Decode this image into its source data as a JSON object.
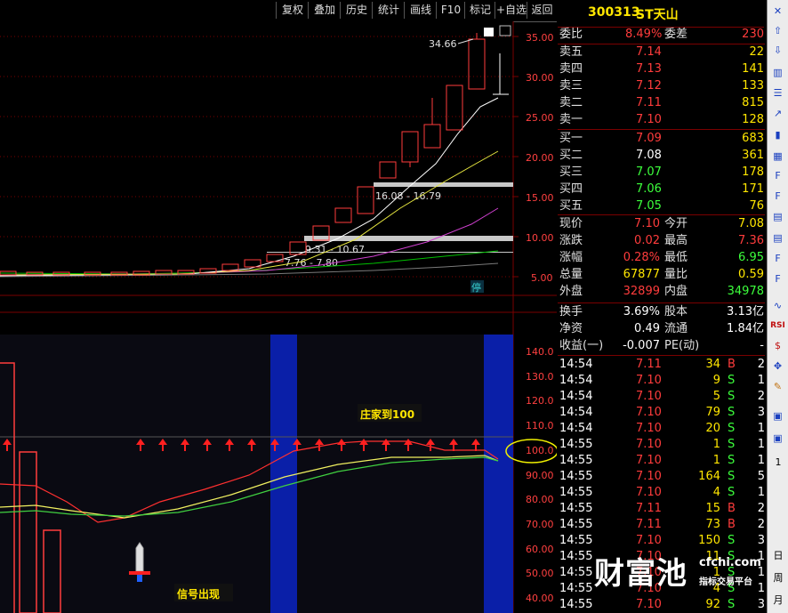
{
  "toolbar": {
    "buttons": [
      "复权",
      "叠加",
      "历史",
      "统计",
      "画线",
      "F10",
      "标记",
      "+自选",
      "返回"
    ]
  },
  "stock": {
    "code": "300313",
    "name": "ST天山"
  },
  "price_chart": {
    "axis_labels": [
      "35.00",
      "30.00",
      "25.00",
      "20.00",
      "15.00",
      "10.00",
      "5.00"
    ],
    "high_label": "34.66",
    "zone_labels": [
      "16.08 - 16.79",
      "9.31 - 10.67",
      "7.76 - 7.80"
    ],
    "suspend_badge": "停"
  },
  "indicator_chart": {
    "axis_labels": [
      "140.0",
      "130.0",
      "120.0",
      "110.0",
      "100.0",
      "90.00",
      "80.00",
      "70.00",
      "60.00",
      "50.00",
      "40.00"
    ],
    "annotation_top": "庄家到100",
    "annotation_bottom": "信号出现"
  },
  "quote": {
    "weibi_label": "委比",
    "weibi_value": "8.49%",
    "weicha_label": "委差",
    "weicha_value": "230",
    "sells": [
      {
        "label": "卖五",
        "price": "7.14",
        "vol": "22"
      },
      {
        "label": "卖四",
        "price": "7.13",
        "vol": "141"
      },
      {
        "label": "卖三",
        "price": "7.12",
        "vol": "133"
      },
      {
        "label": "卖二",
        "price": "7.11",
        "vol": "815"
      },
      {
        "label": "卖一",
        "price": "7.10",
        "vol": "128"
      }
    ],
    "buys": [
      {
        "label": "买一",
        "price": "7.09",
        "vol": "683"
      },
      {
        "label": "买二",
        "price": "7.08",
        "vol": "361"
      },
      {
        "label": "买三",
        "price": "7.07",
        "vol": "178"
      },
      {
        "label": "买四",
        "price": "7.06",
        "vol": "171"
      },
      {
        "label": "买五",
        "price": "7.05",
        "vol": "76"
      }
    ],
    "stats": [
      {
        "l1": "现价",
        "v1": "7.10",
        "l2": "今开",
        "v2": "7.08"
      },
      {
        "l1": "涨跌",
        "v1": "0.02",
        "l2": "最高",
        "v2": "7.36"
      },
      {
        "l1": "涨幅",
        "v1": "0.28%",
        "l2": "最低",
        "v2": "6.95"
      },
      {
        "l1": "总量",
        "v1": "67877",
        "l2": "量比",
        "v2": "0.59"
      },
      {
        "l1": "外盘",
        "v1": "32899",
        "l2": "内盘",
        "v2": "34978"
      }
    ],
    "fin": [
      {
        "l1": "换手",
        "v1": "3.69%",
        "l2": "股本",
        "v2": "3.13亿"
      },
      {
        "l1": "净资",
        "v1": "0.49",
        "l2": "流通",
        "v2": "1.84亿"
      },
      {
        "l1": "收益(一)",
        "v1": "-0.007",
        "l2": "PE(动)",
        "v2": "-"
      }
    ],
    "ticks": [
      {
        "time": "14:54",
        "price": "7.11",
        "vol": "34",
        "side": "B",
        "n": "2"
      },
      {
        "time": "14:54",
        "price": "7.10",
        "vol": "9",
        "side": "S",
        "n": "1"
      },
      {
        "time": "14:54",
        "price": "7.10",
        "vol": "5",
        "side": "S",
        "n": "2"
      },
      {
        "time": "14:54",
        "price": "7.10",
        "vol": "79",
        "side": "S",
        "n": "3"
      },
      {
        "time": "14:54",
        "price": "7.10",
        "vol": "20",
        "side": "S",
        "n": "1"
      },
      {
        "time": "14:55",
        "price": "7.10",
        "vol": "1",
        "side": "S",
        "n": "1"
      },
      {
        "time": "14:55",
        "price": "7.10",
        "vol": "1",
        "side": "S",
        "n": "1"
      },
      {
        "time": "14:55",
        "price": "7.10",
        "vol": "164",
        "side": "S",
        "n": "5"
      },
      {
        "time": "14:55",
        "price": "7.10",
        "vol": "4",
        "side": "S",
        "n": "1"
      },
      {
        "time": "14:55",
        "price": "7.11",
        "vol": "15",
        "side": "B",
        "n": "2"
      },
      {
        "time": "14:55",
        "price": "7.11",
        "vol": "73",
        "side": "B",
        "n": "2"
      },
      {
        "time": "14:55",
        "price": "7.10",
        "vol": "150",
        "side": "S",
        "n": "3"
      },
      {
        "time": "14:55",
        "price": "7.10",
        "vol": "11",
        "side": "S",
        "n": "1"
      },
      {
        "time": "14:55",
        "price": "7.10",
        "vol": "1",
        "side": "S",
        "n": "1"
      },
      {
        "time": "14:55",
        "price": "7.10",
        "vol": "4",
        "side": "S",
        "n": "1"
      },
      {
        "time": "14:55",
        "price": "7.10",
        "vol": "92",
        "side": "S",
        "n": "3"
      }
    ]
  },
  "rightbar": {
    "bottom_texts": [
      "1",
      "日",
      "周",
      "月"
    ]
  },
  "watermark": {
    "main": "财富池",
    "site": "cfchi.com",
    "sub": "指标交易平台"
  },
  "colors": {
    "up": "#ff3c3c",
    "down": "#3cff3c",
    "accent": "#ffe600",
    "panel_blue": "#0a1fa8"
  }
}
